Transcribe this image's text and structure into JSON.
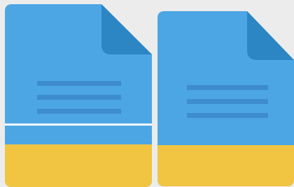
{
  "colors": {
    "background": "#ececec",
    "paper": "#4da6e4",
    "fold": "#2c86c4",
    "lines": "#3d8ccd",
    "band": "#f1c541",
    "divider": "#ffffff"
  },
  "documents": [
    {
      "name": "document-icon-left",
      "icon": "file-document-icon",
      "text_lines": 3,
      "has_divider": true
    },
    {
      "name": "document-icon-right",
      "icon": "file-document-icon",
      "text_lines": 3,
      "has_divider": false
    }
  ]
}
